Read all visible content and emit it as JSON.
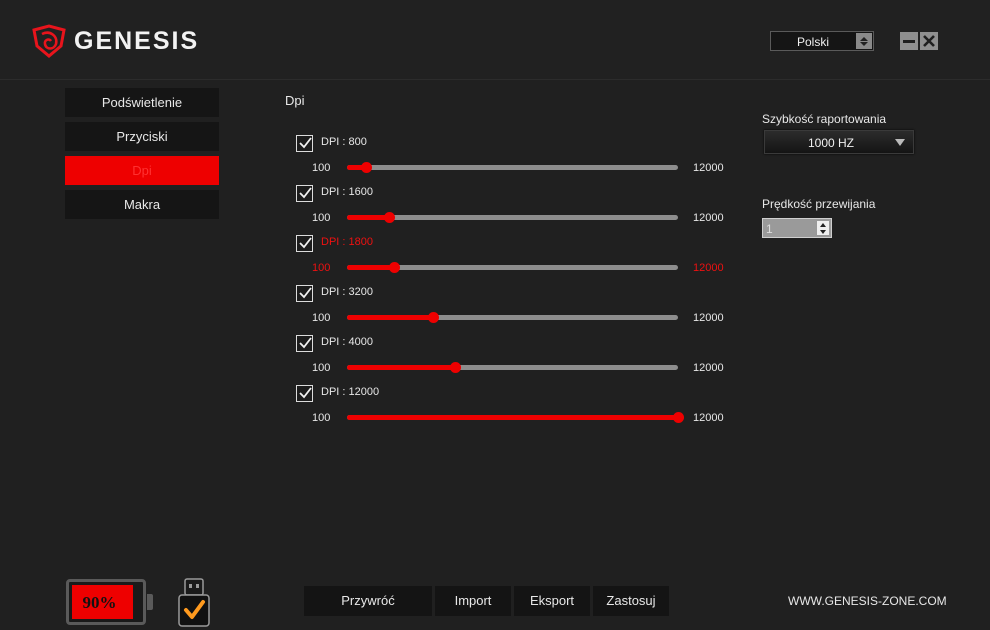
{
  "app": {
    "brand": "GENESIS",
    "language": "Polski",
    "website": "WWW.GENESIS-ZONE.COM"
  },
  "colors": {
    "accent": "#ee0000",
    "background": "#202020",
    "panel": "#151515",
    "track": "#8d8d8d"
  },
  "icons": {
    "logo": "genesis-logo-icon",
    "minimize": "minimize-icon",
    "close": "close-icon",
    "dropdown": "chevron-down-icon",
    "usb": "usb-connected-icon",
    "checkbox": "checkmark-icon"
  },
  "sidebar": {
    "items": [
      {
        "label": "Podświetlenie",
        "active": false
      },
      {
        "label": "Przyciski",
        "active": false
      },
      {
        "label": "Dpi",
        "active": true
      },
      {
        "label": "Makra",
        "active": false
      }
    ]
  },
  "main": {
    "title": "Dpi",
    "range_min_label": "100",
    "range_max_label": "12000",
    "levels": [
      {
        "label": "DPI : 800",
        "value": 800,
        "min": 100,
        "max": 12000,
        "checked": true,
        "selected": false
      },
      {
        "label": "DPI : 1600",
        "value": 1600,
        "min": 100,
        "max": 12000,
        "checked": true,
        "selected": false
      },
      {
        "label": "DPI : 1800",
        "value": 1800,
        "min": 100,
        "max": 12000,
        "checked": true,
        "selected": true
      },
      {
        "label": "DPI : 3200",
        "value": 3200,
        "min": 100,
        "max": 12000,
        "checked": true,
        "selected": false
      },
      {
        "label": "DPI : 4000",
        "value": 4000,
        "min": 100,
        "max": 12000,
        "checked": true,
        "selected": false
      },
      {
        "label": "DPI : 12000",
        "value": 12000,
        "min": 100,
        "max": 12000,
        "checked": true,
        "selected": false
      }
    ]
  },
  "settings": {
    "report_rate_label": "Szybkość raportowania",
    "report_rate_value": "1000 HZ",
    "scroll_speed_label": "Prędkość przewijania",
    "scroll_speed_value": "1"
  },
  "status": {
    "battery_percent": "90%",
    "battery_level": 0.9
  },
  "actions": {
    "restore": "Przywróć",
    "import": "Import",
    "export": "Eksport",
    "apply": "Zastosuj"
  }
}
